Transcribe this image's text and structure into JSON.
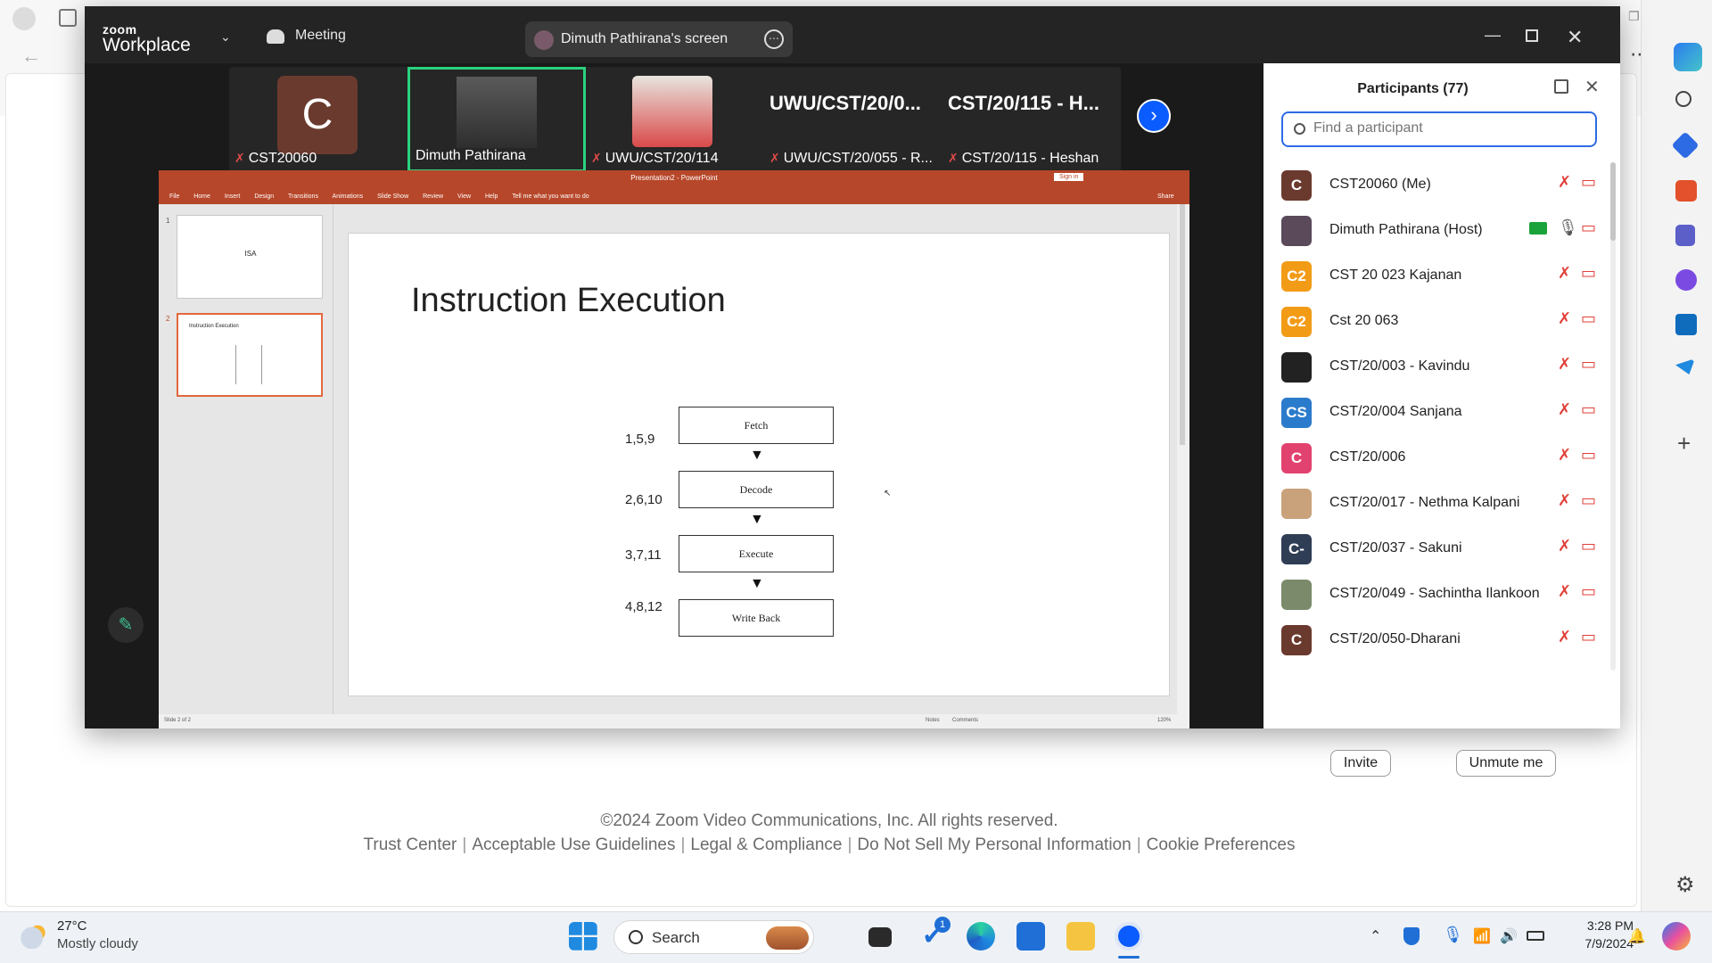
{
  "zoom": {
    "logo_top": "zoom",
    "logo_bottom": "Workplace",
    "meeting_label": "Meeting",
    "share_label": "Dimuth Pathirana's screen"
  },
  "video_strip": {
    "tiles": [
      {
        "initial": "C",
        "name": "CST20060"
      },
      {
        "name": "Dimuth Pathirana"
      },
      {
        "name": "UWU/CST/20/114"
      },
      {
        "big": "UWU/CST/20/0...",
        "name": "UWU/CST/20/055 - R..."
      },
      {
        "big": "CST/20/115 - H...",
        "name": "CST/20/115 - Heshan"
      }
    ]
  },
  "ppt": {
    "window_title": "Presentation2 - PowerPoint",
    "sign_in": "Sign in",
    "share": "Share",
    "tabs": [
      "File",
      "Home",
      "Insert",
      "Design",
      "Transitions",
      "Animations",
      "Slide Show",
      "Review",
      "View",
      "Help",
      "Tell me what you want to do"
    ],
    "thumbs": [
      {
        "num": "1",
        "title": "ISA"
      },
      {
        "num": "2",
        "title": "Instruction Execution"
      }
    ],
    "slide_title": "Instruction Execution",
    "stages": [
      {
        "label": "Fetch",
        "cycles": "1,5,9"
      },
      {
        "label": "Decode",
        "cycles": "2,6,10"
      },
      {
        "label": "Execute",
        "cycles": "3,7,11"
      },
      {
        "label": "Write Back",
        "cycles": "4,8,12"
      }
    ],
    "status_slide": "Slide 2 of 2",
    "status_notes": "Notes",
    "status_comments": "Comments",
    "status_zoom": "120%"
  },
  "participants": {
    "title": "Participants (77)",
    "search_placeholder": "Find a participant",
    "list": [
      {
        "initial": "C",
        "name": "CST20060 (Me)",
        "color": "#6b3a2e"
      },
      {
        "initial": "",
        "name": "Dimuth Pathirana (Host)",
        "color": "#5a4a5a",
        "host": true
      },
      {
        "initial": "C2",
        "name": "CST 20 023 Kajanan",
        "color": "#f29b16"
      },
      {
        "initial": "C2",
        "name": "Cst 20 063",
        "color": "#f29b16"
      },
      {
        "initial": "",
        "name": "CST/20/003 - Kavindu",
        "color": "#222222"
      },
      {
        "initial": "CS",
        "name": "CST/20/004 Sanjana",
        "color": "#2b7bcc"
      },
      {
        "initial": "C",
        "name": "CST/20/006",
        "color": "#e2426f"
      },
      {
        "initial": "",
        "name": "CST/20/017 - Nethma Kalpani",
        "color": "#c9a27b"
      },
      {
        "initial": "C-",
        "name": "CST/20/037 - Sakuni",
        "color": "#2f3d55"
      },
      {
        "initial": "",
        "name": "CST/20/049 - Sachintha Ilankoon",
        "color": "#7a8a6a"
      },
      {
        "initial": "C",
        "name": "CST/20/050-Dharani",
        "color": "#6b3a2e"
      }
    ],
    "invite": "Invite",
    "unmute": "Unmute me"
  },
  "browser_footer": {
    "copyright": "©2024 Zoom Video Communications, Inc. All rights reserved.",
    "links": [
      "Trust Center",
      "Acceptable Use Guidelines",
      "Legal & Compliance",
      "Do Not Sell My Personal Information",
      "Cookie Preferences"
    ]
  },
  "taskbar": {
    "weather_temp": "27°C",
    "weather_desc": "Mostly cloudy",
    "search": "Search",
    "todo_badge": "1",
    "time": "3:28 PM",
    "date": "7/9/2024"
  }
}
